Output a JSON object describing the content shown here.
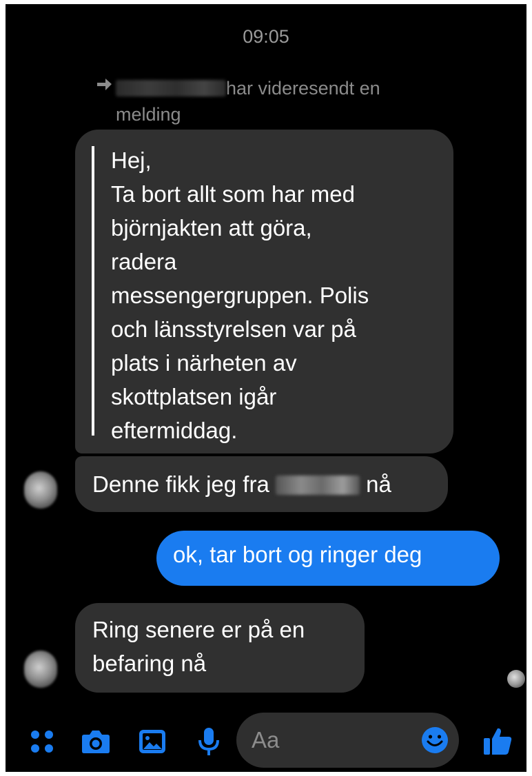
{
  "timestamp": "09:05",
  "forward_notice": {
    "icon": "forward-arrow-icon",
    "text": "har videresendt en melding"
  },
  "forwarded_message": {
    "lines": [
      "Hej,",
      "Ta bort allt som har med",
      "björnjakten att göra,",
      "radera",
      "messengergruppen. Polis",
      "och länsstyrelsen var på",
      "plats i närheten av",
      "skottplatsen igår",
      "eftermiddag."
    ]
  },
  "received_1": {
    "prefix": "Denne fikk jeg fra",
    "suffix": "nå"
  },
  "sent_1": {
    "text": "ok, tar bort og ringer deg"
  },
  "received_2": {
    "lines": [
      "Ring senere er på en",
      "befaring nå"
    ]
  },
  "composer": {
    "placeholder": "Aa"
  },
  "toolbar": {
    "icons": [
      "apps-icon",
      "camera-icon",
      "gallery-icon",
      "microphone-icon",
      "emoji-icon",
      "thumbs-up-icon"
    ]
  },
  "colors": {
    "background": "#000000",
    "received_bubble": "#303030",
    "sent_bubble": "#1a7cf0",
    "accent": "#1a7cf0"
  }
}
